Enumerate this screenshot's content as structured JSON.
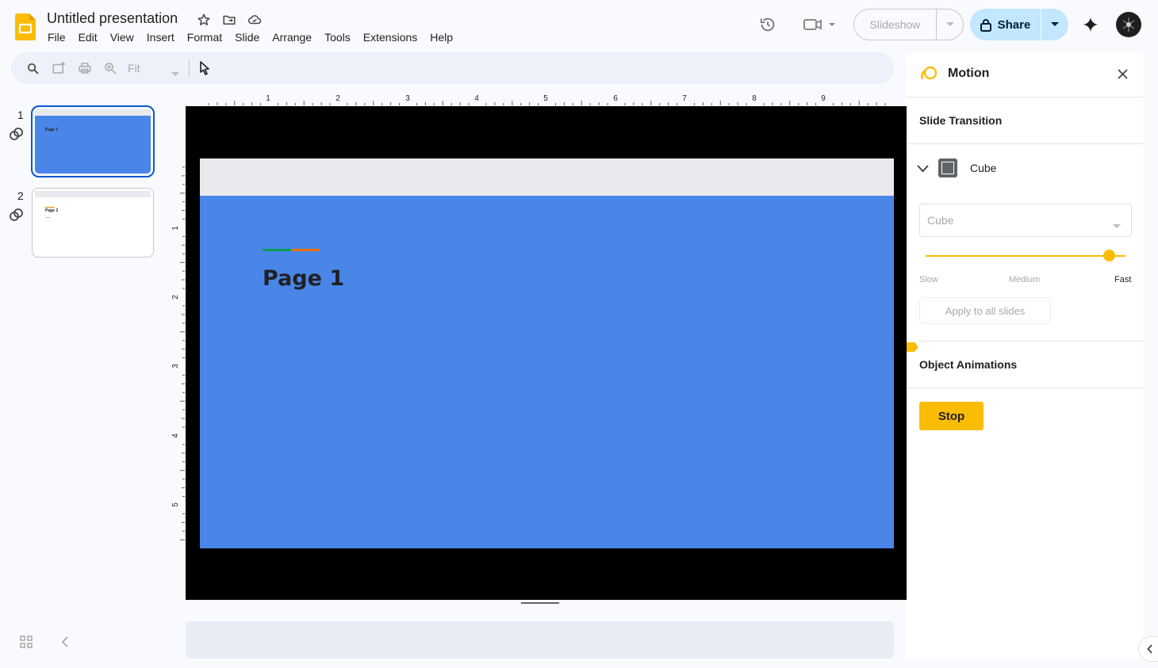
{
  "doc": {
    "title": "Untitled presentation"
  },
  "menu": [
    "File",
    "Edit",
    "View",
    "Insert",
    "Format",
    "Slide",
    "Arrange",
    "Tools",
    "Extensions",
    "Help"
  ],
  "header": {
    "slideshow_label": "Slideshow",
    "share_label": "Share"
  },
  "toolbar": {
    "zoom_label": "Fit"
  },
  "filmstrip": [
    {
      "number": "1",
      "title": "Page 1"
    },
    {
      "number": "2",
      "title": "Page 2"
    }
  ],
  "ruler": {
    "horizontal": [
      "1",
      "2",
      "3",
      "4",
      "5",
      "6",
      "7",
      "8",
      "9"
    ],
    "vertical": [
      "1",
      "2",
      "3",
      "4",
      "5"
    ]
  },
  "slide": {
    "title": "Page 1",
    "bg_color": "#4a86e8"
  },
  "motion_panel": {
    "title": "Motion",
    "section_transition": "Slide Transition",
    "transition_name": "Cube",
    "type_select_value": "Cube",
    "speed_labels": {
      "slow": "Slow",
      "medium": "Medium",
      "fast": "Fast"
    },
    "speed_level": 0.92,
    "apply_all_label": "Apply to all slides",
    "section_objects": "Object Animations",
    "stop_label": "Stop"
  },
  "colors": {
    "accent": "#fbbc04",
    "share_bg": "#c2e7ff",
    "selection": "#0b57d0"
  }
}
